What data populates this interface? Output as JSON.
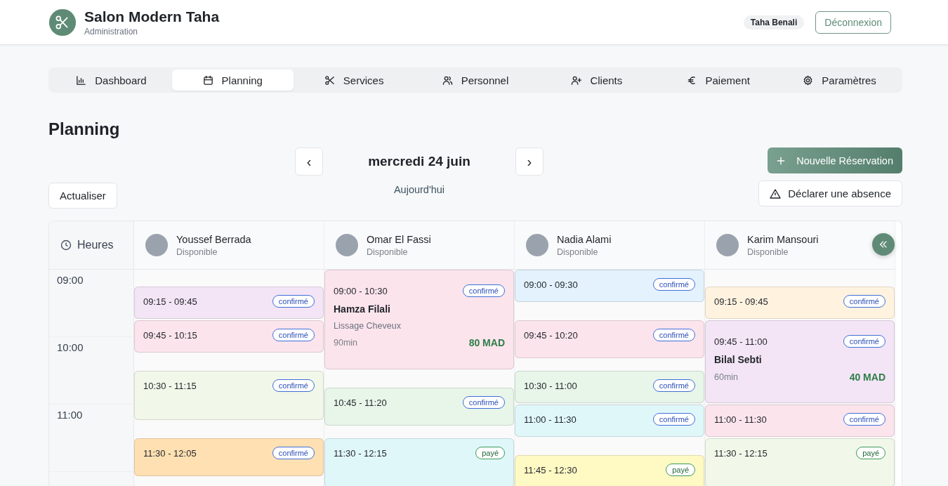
{
  "header": {
    "title": "Salon Modern Taha",
    "subtitle": "Administration",
    "user": "Taha Benali",
    "logout": "Déconnexion"
  },
  "tabs": [
    {
      "label": "Dashboard",
      "selected": false
    },
    {
      "label": "Planning",
      "selected": true
    },
    {
      "label": "Services",
      "selected": false
    },
    {
      "label": "Personnel",
      "selected": false
    },
    {
      "label": "Clients",
      "selected": false
    },
    {
      "label": "Paiement",
      "selected": false
    },
    {
      "label": "Paramètres",
      "selected": false
    }
  ],
  "page_title": "Planning",
  "date_nav": {
    "prev": "‹",
    "date": "mercredi 24 juin",
    "next": "›",
    "today": "Aujourd'hui"
  },
  "actions": {
    "refresh": "Actualiser",
    "new_booking": "Nouvelle Réservation",
    "absence": "Déclarer une absence"
  },
  "schedule": {
    "hours_heading": "Heures",
    "hours": [
      "09:00",
      "10:00",
      "11:00"
    ],
    "staff": [
      {
        "name": "Youssef Berrada",
        "status": "Disponible",
        "appointments": [
          {
            "time": "09:15 - 09:45",
            "status": "confirmé",
            "kind": "confirmed",
            "color": "#f3e5f5"
          },
          {
            "time": "09:45 - 10:15",
            "status": "confirmé",
            "kind": "confirmed",
            "color": "#fce4ec"
          },
          {
            "time": "10:30 - 11:15",
            "status": "confirmé",
            "kind": "confirmed",
            "color": "#f1f8e9"
          },
          {
            "time": "11:30 - 12:05",
            "status": "confirmé",
            "kind": "confirmed",
            "color": "#ffe0b2"
          }
        ]
      },
      {
        "name": "Omar El Fassi",
        "status": "Disponible",
        "appointments": [
          {
            "time": "09:00 - 10:30",
            "status": "confirmé",
            "kind": "confirmed",
            "color": "#fce4ec",
            "client": "Hamza Filali",
            "service": "Lissage Cheveux",
            "duration": "90min",
            "price": "80 MAD"
          },
          {
            "time": "10:45 - 11:20",
            "status": "confirmé",
            "kind": "confirmed",
            "color": "#e8f5e9"
          },
          {
            "time": "11:30 - 12:15",
            "status": "payé",
            "kind": "paid",
            "color": "#e0f7fa"
          }
        ]
      },
      {
        "name": "Nadia Alami",
        "status": "Disponible",
        "appointments": [
          {
            "time": "09:00 - 09:30",
            "status": "confirmé",
            "kind": "confirmed",
            "color": "#e3f2fd"
          },
          {
            "time": "09:45 - 10:20",
            "status": "confirmé",
            "kind": "confirmed",
            "color": "#fce4ec"
          },
          {
            "time": "10:30 - 11:00",
            "status": "confirmé",
            "kind": "confirmed",
            "color": "#e8f5e9"
          },
          {
            "time": "11:00 - 11:30",
            "status": "confirmé",
            "kind": "confirmed",
            "color": "#e0f7fa"
          },
          {
            "time": "11:45 - 12:30",
            "status": "payé",
            "kind": "paid",
            "color": "#fff9c4"
          }
        ]
      },
      {
        "name": "Karim Mansouri",
        "status": "Disponible",
        "appointments": [
          {
            "time": "09:15 - 09:45",
            "status": "confirmé",
            "kind": "confirmed",
            "color": "#fff3e0"
          },
          {
            "time": "09:45 - 11:00",
            "status": "confirmé",
            "kind": "confirmed",
            "color": "#f3e5f5",
            "client": "Bilal Sebti",
            "duration": "60min",
            "price": "40 MAD"
          },
          {
            "time": "11:00 - 11:30",
            "status": "confirmé",
            "kind": "confirmed",
            "color": "#fce4ec"
          },
          {
            "time": "11:30 - 12:15",
            "status": "payé",
            "kind": "paid",
            "color": "#f1f8e9"
          }
        ]
      }
    ]
  }
}
